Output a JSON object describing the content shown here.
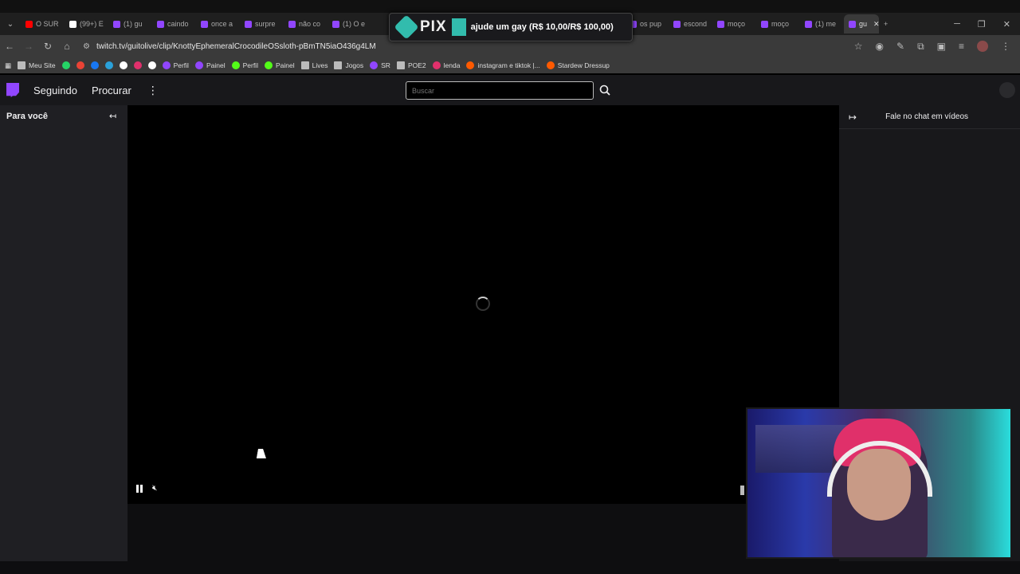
{
  "browser": {
    "tabs": [
      {
        "label": "O SUR",
        "icon": "youtube-icon",
        "color": "#ff0000"
      },
      {
        "label": "(99+) E",
        "icon": "tiktok-icon",
        "color": "#ffffff"
      },
      {
        "label": "(1) gu",
        "icon": "twitch-icon",
        "color": "#9146ff"
      },
      {
        "label": "caindo",
        "icon": "twitch-icon",
        "color": "#9146ff"
      },
      {
        "label": "once a",
        "icon": "twitch-icon",
        "color": "#9146ff"
      },
      {
        "label": "surpre",
        "icon": "twitch-icon",
        "color": "#9146ff"
      },
      {
        "label": "não co",
        "icon": "twitch-icon",
        "color": "#9146ff"
      },
      {
        "label": "(1) O e",
        "icon": "twitch-icon",
        "color": "#9146ff"
      },
      {
        "label": "os pup",
        "icon": "twitch-icon",
        "color": "#9146ff"
      },
      {
        "label": "escond",
        "icon": "twitch-icon",
        "color": "#9146ff"
      },
      {
        "label": "moço",
        "icon": "twitch-icon",
        "color": "#9146ff"
      },
      {
        "label": "moço",
        "icon": "twitch-icon",
        "color": "#9146ff"
      },
      {
        "label": "(1) me",
        "icon": "twitch-icon",
        "color": "#9146ff"
      },
      {
        "label": "gu",
        "icon": "twitch-icon",
        "color": "#9146ff",
        "active": true
      }
    ],
    "url": "twitch.tv/guitolive/clip/KnottyEphemeralCrocodileOSsloth-pBmTN5iaO436g4LM",
    "bookmarks": [
      {
        "label": "Meu Site",
        "icon": "folder-icon"
      },
      {
        "label": "",
        "icon": "whatsapp-icon"
      },
      {
        "label": "",
        "icon": "gmail-icon"
      },
      {
        "label": "",
        "icon": "facebook-icon"
      },
      {
        "label": "",
        "icon": "telegram-icon"
      },
      {
        "label": "",
        "icon": "x-icon"
      },
      {
        "label": "",
        "icon": "instagram-icon"
      },
      {
        "label": "",
        "icon": "tiktok-icon"
      },
      {
        "label": "Perfil",
        "icon": "twitch-icon"
      },
      {
        "label": "Painel",
        "icon": "twitch-icon"
      },
      {
        "label": "Perfil",
        "icon": "kick-icon"
      },
      {
        "label": "Painel",
        "icon": "kick-icon"
      },
      {
        "label": "Lives",
        "icon": "folder-icon"
      },
      {
        "label": "Jogos",
        "icon": "folder-icon"
      },
      {
        "label": "SR",
        "icon": "twitch-icon"
      },
      {
        "label": "POE2",
        "icon": "folder-icon"
      },
      {
        "label": "lenda",
        "icon": "instagram-icon"
      },
      {
        "label": "instagram e tiktok |...",
        "icon": "bookmark-icon"
      },
      {
        "label": "Stardew Dressup",
        "icon": "bookmark-icon"
      }
    ]
  },
  "pix": {
    "logo_text": "PIX",
    "message": "ajude um gay (R$ 10,00/R$ 100,00)",
    "progress": 0.1
  },
  "twitch": {
    "nav": {
      "following": "Seguindo",
      "browse": "Procurar"
    },
    "search": {
      "placeholder": "Buscar"
    },
    "sidebar": {
      "title": "Para você"
    },
    "chat": {
      "title": "Fale no chat em vídeos"
    }
  }
}
